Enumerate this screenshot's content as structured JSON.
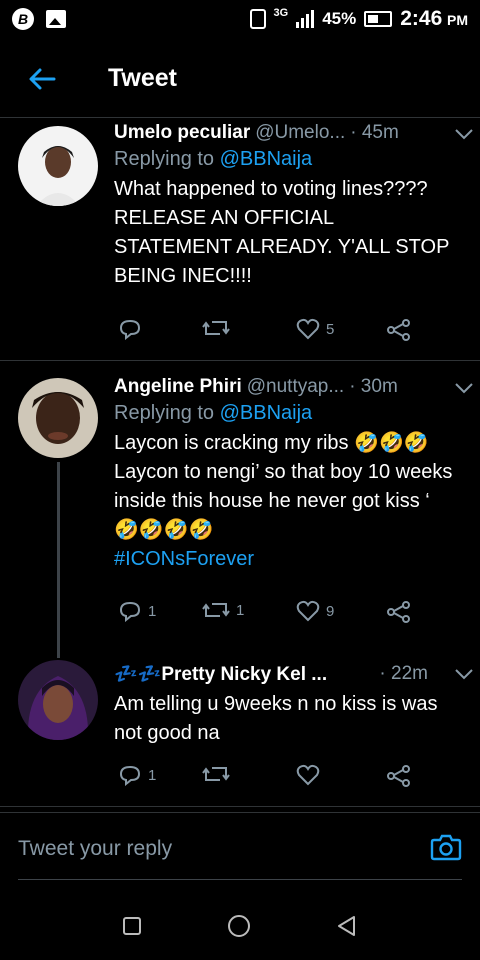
{
  "status_bar": {
    "app_badge": "B",
    "network": "3G",
    "battery": "45%",
    "time": "2:46",
    "ampm": "PM"
  },
  "header": {
    "title": "Tweet",
    "back_icon": "arrow-left-icon"
  },
  "colors": {
    "accent": "#1da1f2",
    "muted": "#8899a6",
    "background": "#000000",
    "divider": "#2f3336"
  },
  "tweets": [
    {
      "name": "Umelo peculiar",
      "handle": "@Umelo...",
      "time": "· 45m",
      "reply_prefix": "Replying to ",
      "reply_to": "@BBNaija",
      "text": "What happened to voting lines???? RELEASE AN OFFICIAL STATEMENT ALREADY. Y'ALL STOP BEING INEC!!!!",
      "hashtag": "",
      "replies": "",
      "retweets": "",
      "likes": "5"
    },
    {
      "name": "Angeline Phiri",
      "handle": "@nuttyap...",
      "time": "· 30m",
      "reply_prefix": "Replying to ",
      "reply_to": "@BBNaija",
      "text": "Laycon is cracking my ribs 🤣🤣🤣 Laycon to nengi’ so that boy 10 weeks inside this house he never got kiss ‘ 🤣🤣🤣🤣",
      "hashtag": "#ICONsForever",
      "replies": "1",
      "retweets": "1",
      "likes": "9"
    },
    {
      "name": "💤💤Pretty Nicky Kel ...",
      "handle": "",
      "time": "· 22m",
      "reply_prefix": "",
      "reply_to": "",
      "text": "Am telling u 9weeks n no kiss is was not good na",
      "hashtag": "",
      "replies": "1",
      "retweets": "",
      "likes": ""
    }
  ],
  "compose": {
    "placeholder": "Tweet your reply",
    "camera_icon": "camera-icon"
  },
  "nav": {
    "icons": [
      "recents-square-icon",
      "home-circle-icon",
      "back-triangle-icon"
    ]
  }
}
